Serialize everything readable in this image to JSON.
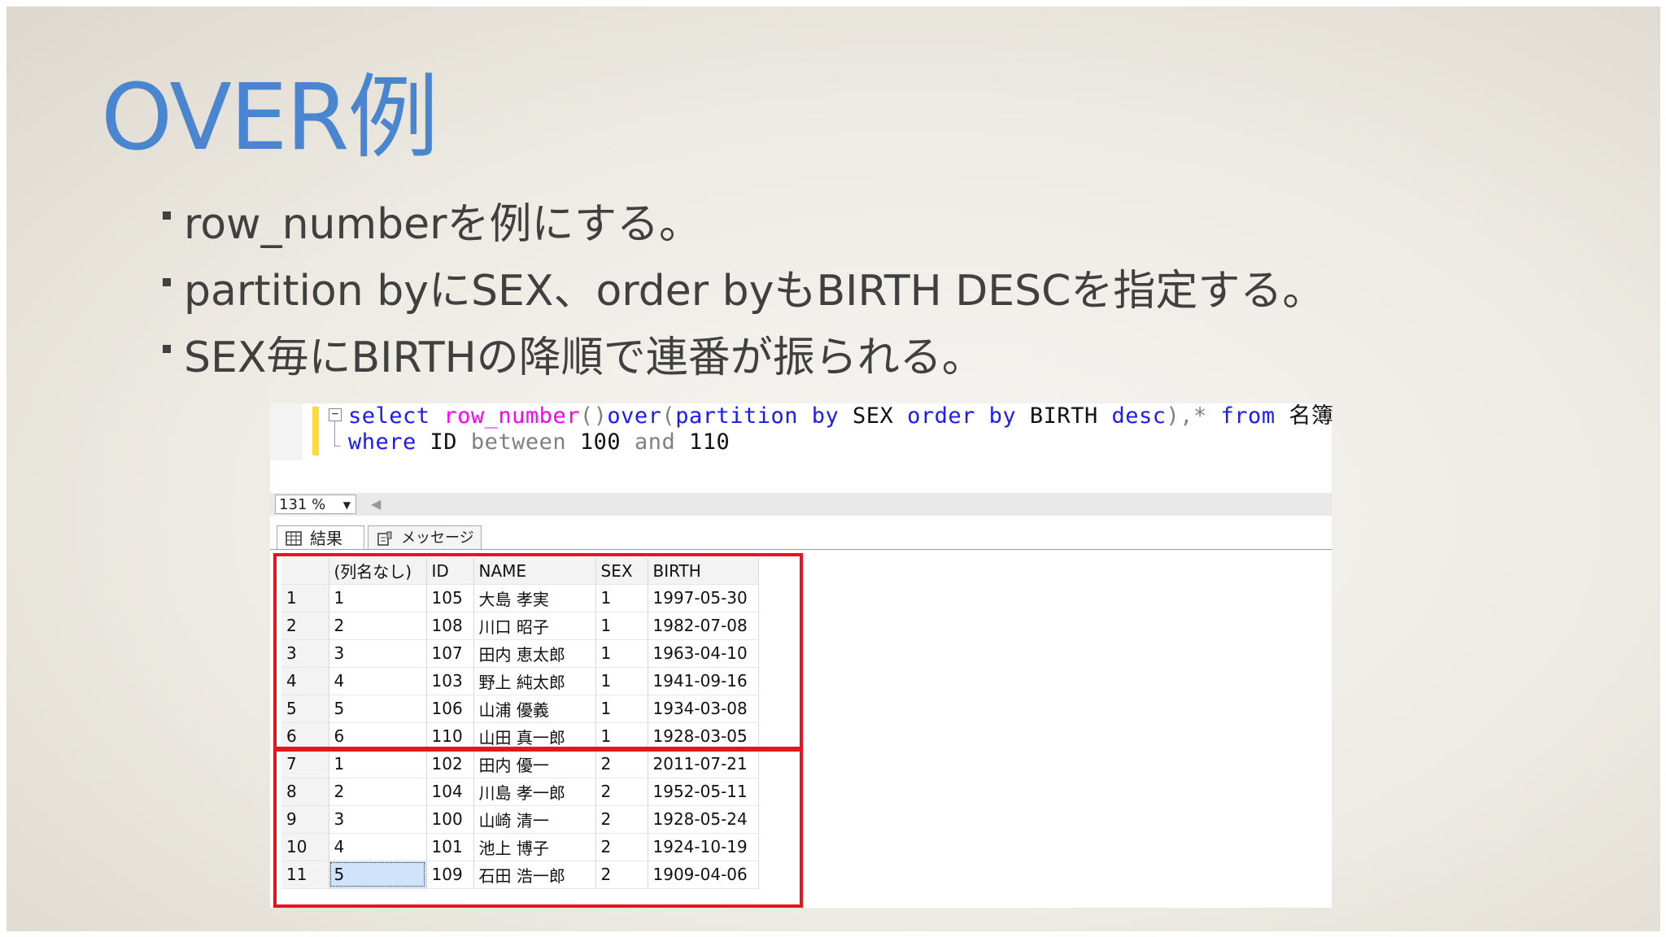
{
  "title": "OVER例",
  "bullets": [
    "row_numberを例にする。",
    "partition byにSEX、order byもBIRTH DESCを指定する。",
    "SEX毎にBIRTHの降順で連番が振られる。"
  ],
  "editor": {
    "line1": {
      "select": "select",
      "row_number": "row_number",
      "paren": "()",
      "over": "over",
      "open": "(",
      "partition": "partition",
      "by1": "by",
      "sex": "SEX",
      "order": "order",
      "by2": "by",
      "birth": "BIRTH",
      "desc": "desc",
      "close": "),*",
      "from": "from",
      "table": "名簿"
    },
    "line2": {
      "where": "where",
      "id": "ID",
      "between": "between",
      "low": "100",
      "and": "and",
      "high": "110"
    }
  },
  "zoom": "131 %",
  "tabs": [
    "結果",
    "メッセージ"
  ],
  "grid": {
    "columns": [
      "(列名なし)",
      "ID",
      "NAME",
      "SEX",
      "BIRTH"
    ],
    "rows": [
      [
        "1",
        "1",
        "105",
        "大島 孝実",
        "1",
        "1997-05-30"
      ],
      [
        "2",
        "2",
        "108",
        "川口 昭子",
        "1",
        "1982-07-08"
      ],
      [
        "3",
        "3",
        "107",
        "田内 恵太郎",
        "1",
        "1963-04-10"
      ],
      [
        "4",
        "4",
        "103",
        "野上 純太郎",
        "1",
        "1941-09-16"
      ],
      [
        "5",
        "5",
        "106",
        "山浦 優義",
        "1",
        "1934-03-08"
      ],
      [
        "6",
        "6",
        "110",
        "山田 真一郎",
        "1",
        "1928-03-05"
      ],
      [
        "7",
        "1",
        "102",
        "田内 優一",
        "2",
        "2011-07-21"
      ],
      [
        "8",
        "2",
        "104",
        "川島 孝一郎",
        "2",
        "1952-05-11"
      ],
      [
        "9",
        "3",
        "100",
        "山崎 清一",
        "2",
        "1928-05-24"
      ],
      [
        "10",
        "4",
        "101",
        "池上 博子",
        "2",
        "1924-10-19"
      ],
      [
        "11",
        "5",
        "109",
        "石田 浩一郎",
        "2",
        "1909-04-06"
      ]
    ]
  },
  "colors": {
    "title": "#4a86cf",
    "highlight": "#e8141e",
    "keyword": "#1a1aff",
    "function": "#ff00ff"
  }
}
